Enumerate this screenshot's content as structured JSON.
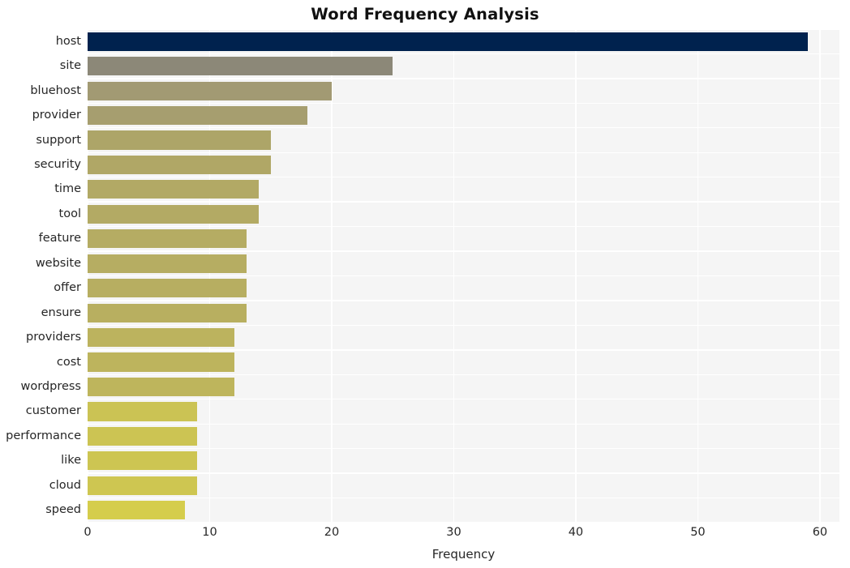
{
  "chart_data": {
    "type": "bar",
    "orientation": "horizontal",
    "title": "Word Frequency Analysis",
    "xlabel": "Frequency",
    "ylabel": "",
    "xlim": [
      0,
      61.6
    ],
    "xticks": [
      0,
      10,
      20,
      30,
      40,
      50,
      60
    ],
    "xtick_labels": [
      "0",
      "10",
      "20",
      "30",
      "40",
      "50",
      "60"
    ],
    "grid": true,
    "grid_axis": "both",
    "legend": null,
    "categories": [
      "host",
      "site",
      "bluehost",
      "provider",
      "support",
      "security",
      "time",
      "tool",
      "feature",
      "website",
      "offer",
      "ensure",
      "providers",
      "cost",
      "wordpress",
      "customer",
      "performance",
      "like",
      "cloud",
      "speed"
    ],
    "values": [
      59,
      25,
      20,
      18,
      15,
      15,
      14,
      14,
      13,
      13,
      13,
      13,
      12,
      12,
      12,
      9,
      9,
      9,
      9,
      8
    ],
    "bar_colors": [
      "#00224e",
      "#8c8878",
      "#a29a73",
      "#a69e6f",
      "#ada568",
      "#b0a766",
      "#b2a965",
      "#b3aa64",
      "#b5ac63",
      "#b6ad62",
      "#b7ae61",
      "#b8af60",
      "#bcb35e",
      "#bdb45d",
      "#beb55c",
      "#cbc354",
      "#ccc453",
      "#cdc552",
      "#cec651",
      "#d5cd4c"
    ],
    "plot_bg": "#f5f5f5",
    "grid_color": "#ffffff",
    "figure_bg": "#ffffff",
    "text_color": "#262626"
  }
}
